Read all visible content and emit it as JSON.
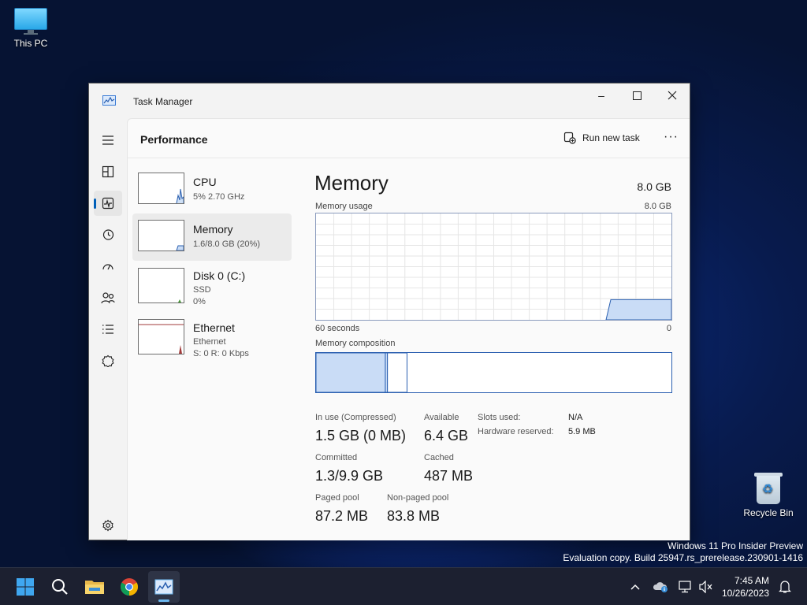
{
  "desktop": {
    "icons": [
      {
        "label": "This PC",
        "icon": "monitor-icon"
      },
      {
        "label": "Recycle Bin",
        "icon": "recycle-bin-icon"
      }
    ],
    "watermark": {
      "line1": "Windows 11 Pro Insider Preview",
      "line2": "Evaluation copy. Build 25947.rs_prerelease.230901-1416"
    }
  },
  "window": {
    "title": "Task Manager",
    "controls": {
      "minimize": "–",
      "maximize": "☐",
      "close": "✕"
    },
    "sidebar": [
      {
        "name": "hamburger-menu-icon"
      },
      {
        "name": "processes-icon"
      },
      {
        "name": "performance-icon",
        "active": true
      },
      {
        "name": "app-history-icon"
      },
      {
        "name": "startup-apps-icon"
      },
      {
        "name": "users-icon"
      },
      {
        "name": "details-icon"
      },
      {
        "name": "services-icon"
      },
      {
        "name": "settings-icon"
      }
    ],
    "header": {
      "title": "Performance",
      "run_new_task": "Run new task",
      "more": "···"
    }
  },
  "perf_items": [
    {
      "name": "CPU",
      "sub1": "5%  2.70 GHz",
      "sub2": "",
      "sub3": ""
    },
    {
      "name": "Memory",
      "sub1": "1.6/8.0 GB (20%)",
      "sub2": "",
      "sub3": "",
      "active": true
    },
    {
      "name": "Disk 0 (C:)",
      "sub1": "SSD",
      "sub2": "0%",
      "sub3": ""
    },
    {
      "name": "Ethernet",
      "sub1": "Ethernet",
      "sub2": "S: 0 R: 0 Kbps",
      "sub3": ""
    }
  ],
  "detail": {
    "title": "Memory",
    "total": "8.0 GB",
    "usage_label": "Memory usage",
    "usage_max": "8.0 GB",
    "x_left": "60 seconds",
    "x_right": "0",
    "composition_label": "Memory composition",
    "in_use_label": "In use (Compressed)",
    "in_use_value": "1.5 GB (0 MB)",
    "available_label": "Available",
    "available_value": "6.4 GB",
    "committed_label": "Committed",
    "committed_value": "1.3/9.9 GB",
    "cached_label": "Cached",
    "cached_value": "487 MB",
    "paged_label": "Paged pool",
    "paged_value": "87.2 MB",
    "nonpaged_label": "Non-paged pool",
    "nonpaged_value": "83.8 MB",
    "slots_label": "Slots used:",
    "slots_value": "N/A",
    "hw_label": "Hardware reserved:",
    "hw_value": "5.9 MB",
    "usage_level_fraction": 0.19,
    "composition_fractions": {
      "in_use": 0.195,
      "modified": 0.006,
      "standby": 0.055
    }
  },
  "taskbar": {
    "time": "7:45 AM",
    "date": "10/26/2023",
    "pins": [
      "start-icon",
      "search-icon",
      "file-explorer-icon",
      "chrome-icon",
      "task-manager-icon"
    ]
  },
  "colors": {
    "accent": "#005fb8",
    "graph_fill": "#c9dcf6",
    "graph_line": "#2a5fb0",
    "taskbar": "#1c2030"
  }
}
